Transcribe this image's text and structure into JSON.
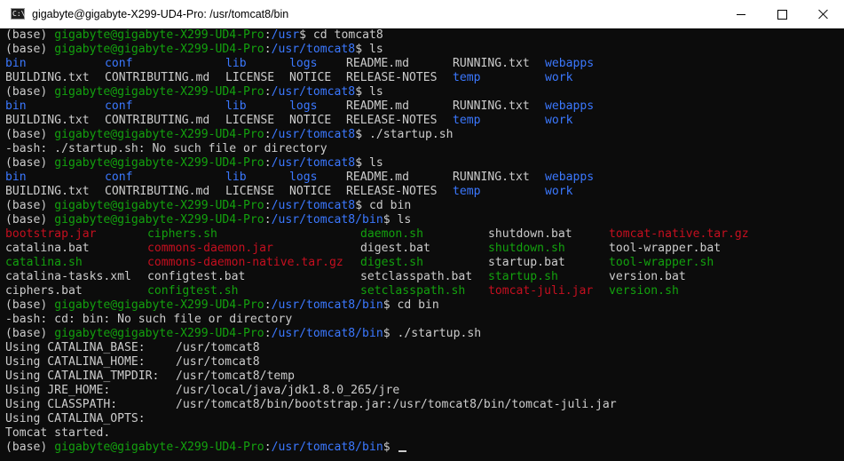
{
  "window": {
    "title": "gigabyte@gigabyte-X299-UD4-Pro: /usr/tomcat8/bin",
    "icon": "terminal-app-icon",
    "icon_text": "C:\\"
  },
  "colors": {
    "background": "#0c0c0c",
    "text": "#cccccc",
    "green": "#13a10e",
    "blue": "#3b78ff",
    "red": "#c50f1f"
  },
  "prompt": {
    "env": "(base) ",
    "user_host": "gigabyte@gigabyte-X299-UD4-Pro",
    "colon": ":",
    "path_usr": "/usr",
    "path_tomcat8": "/usr/tomcat8",
    "path_bin": "/usr/tomcat8/bin",
    "dollar": "$ "
  },
  "commands": {
    "cd_tomcat8": "cd tomcat8",
    "ls": "ls",
    "startup": "./startup.sh",
    "cd_bin": "cd bin"
  },
  "ls_tomcat8": {
    "row1": [
      "bin",
      "conf",
      "lib",
      "logs",
      "README.md",
      "RUNNING.txt",
      "webapps"
    ],
    "row2": [
      "BUILDING.txt",
      "CONTRIBUTING.md",
      "LICENSE",
      "NOTICE",
      "RELEASE-NOTES",
      "temp",
      "work"
    ]
  },
  "ls_bin": {
    "row1": [
      "bootstrap.jar",
      "ciphers.sh",
      "daemon.sh",
      "shutdown.bat",
      "tomcat-native.tar.gz"
    ],
    "row2": [
      "catalina.bat",
      "commons-daemon.jar",
      "digest.bat",
      "shutdown.sh",
      "tool-wrapper.bat"
    ],
    "row3": [
      "catalina.sh",
      "commons-daemon-native.tar.gz",
      "digest.sh",
      "startup.bat",
      "tool-wrapper.sh"
    ],
    "row4": [
      "catalina-tasks.xml",
      "configtest.bat",
      "setclasspath.bat",
      "startup.sh",
      "version.bat"
    ],
    "row5": [
      "ciphers.bat",
      "configtest.sh",
      "setclasspath.sh",
      "tomcat-juli.jar",
      "version.sh"
    ]
  },
  "errors": {
    "startup_missing": "-bash: ./startup.sh: No such file or directory",
    "cd_bin_missing": "-bash: cd: bin: No such file or directory"
  },
  "startup_output": {
    "catalina_base_label": "Using CATALINA_BASE:",
    "catalina_base_value": "/usr/tomcat8",
    "catalina_home_label": "Using CATALINA_HOME:",
    "catalina_home_value": "/usr/tomcat8",
    "catalina_tmpdir_label": "Using CATALINA_TMPDIR:",
    "catalina_tmpdir_value": "/usr/tomcat8/temp",
    "jre_home_label": "Using JRE_HOME:",
    "jre_home_value": "/usr/local/java/jdk1.8.0_265/jre",
    "classpath_label": "Using CLASSPATH:",
    "classpath_value": "/usr/tomcat8/bin/bootstrap.jar:/usr/tomcat8/bin/tomcat-juli.jar",
    "catalina_opts_label": "Using CATALINA_OPTS:",
    "started": "Tomcat started."
  }
}
